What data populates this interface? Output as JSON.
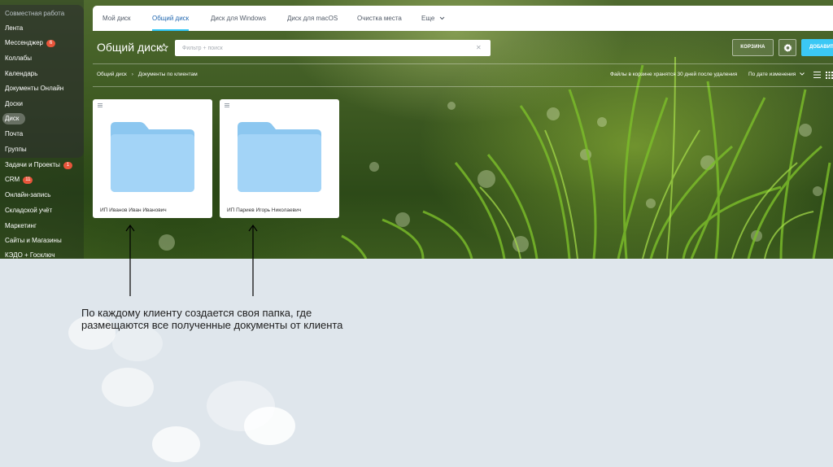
{
  "sidebar": {
    "items": [
      {
        "label": "Совместная работа",
        "badge": null
      },
      {
        "label": "Лента",
        "badge": null
      },
      {
        "label": "Мессенджер",
        "badge": "6"
      },
      {
        "label": "Коллабы",
        "badge": null
      },
      {
        "label": "Календарь",
        "badge": null
      },
      {
        "label": "Документы Онлайн",
        "badge": null
      },
      {
        "label": "Доски",
        "badge": null
      },
      {
        "label": "Диск",
        "badge": null
      },
      {
        "label": "Почта",
        "badge": null
      },
      {
        "label": "Группы",
        "badge": null
      },
      {
        "label": "Задачи и Проекты",
        "badge": "1"
      },
      {
        "label": "CRM",
        "badge": "11"
      },
      {
        "label": "Онлайн-запись",
        "badge": null
      },
      {
        "label": "Складской учёт",
        "badge": null
      },
      {
        "label": "Маркетинг",
        "badge": null
      },
      {
        "label": "Сайты и Магазины",
        "badge": null
      },
      {
        "label": "КЭДО + Госключ",
        "badge": null
      }
    ],
    "active_item": "Диск"
  },
  "tabs": [
    "Мой диск",
    "Общий диск",
    "Диск для Windows",
    "Диск для macOS",
    "Очистка места",
    "Еще"
  ],
  "active_tab": "Общий диск",
  "header": {
    "title": "Общий диск",
    "search_placeholder": "Фильтр + поиск",
    "trash_button": "КОРЗИНА",
    "add_button": "ДОБАВИТЬ"
  },
  "breadcrumb": [
    "Общий диск",
    "Документы по клиентам"
  ],
  "trash_note": "Файлы в корзине хранятся 30 дней после удаления",
  "sort_label": "По дате изменения",
  "folders": [
    {
      "name": "ИП Иванов Иван Иванович"
    },
    {
      "name": "ИП Париев Игорь Николаевич"
    }
  ],
  "caption_lines": [
    "По каждому клиенту создается своя папка, где",
    "размещаются все полученные документы от клиента"
  ],
  "colors": {
    "accent": "#2fc6f6",
    "add_button": "#3bc8f5",
    "folder": "#a3d4f7",
    "badge": "#e8553b"
  }
}
